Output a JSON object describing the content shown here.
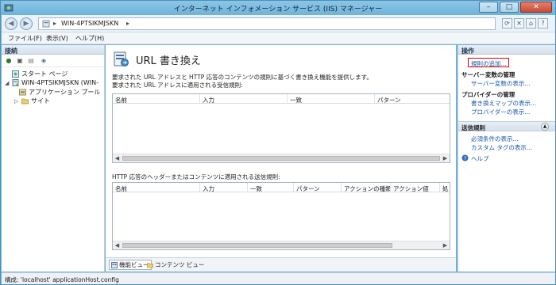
{
  "window": {
    "title": "インターネット インフォメーション サービス (IIS) マネージャー"
  },
  "address": {
    "segments": [
      "WIN-4PTSIKMJSKN"
    ]
  },
  "menu": {
    "items": [
      "ファイル(F)",
      "表示(V)",
      "ヘルプ(H)"
    ]
  },
  "connections": {
    "header": "接続",
    "tree": [
      {
        "label": "スタート ページ",
        "icon": "start-page-icon"
      },
      {
        "label": "WIN-4PTSIKMJSKN (WIN-",
        "icon": "server-icon"
      },
      {
        "label": "アプリケーション プール",
        "icon": "app-pool-icon"
      },
      {
        "label": "サイト",
        "icon": "sites-folder-icon"
      }
    ]
  },
  "feature": {
    "title": "URL 書き換え",
    "description": "要求された URL アドレスと HTTP 応答のコンテンツの規則に基づく書き換え機能を提供します。",
    "inbound_label": "要求された URL アドレスに適用される受信規則:",
    "inbound_columns": [
      "名前",
      "入力",
      "一致",
      "パターン"
    ],
    "outbound_label": "HTTP 応答のヘッダーまたはコンテンツに適用される送信規則:",
    "outbound_columns": [
      "名前",
      "入力",
      "一致",
      "パターン",
      "アクションの種類",
      "アクション値",
      "処"
    ]
  },
  "view_tabs": [
    "機能ビュー",
    "コンテンツ ビュー"
  ],
  "actions": {
    "header": "操作",
    "add_rule": "規則の追加...",
    "server_vars_head": "サーバー変数の管理",
    "server_vars_view": "サーバー変数の表示...",
    "providers_head": "プロバイダーの管理",
    "rewrite_maps": "書き換えマップの表示...",
    "providers_view": "プロバイダーの表示...",
    "outbound_section": "送信規則",
    "preconditions": "必須条件の表示...",
    "custom_tags": "カスタム タグの表示...",
    "help": "ヘルプ"
  },
  "status": {
    "text": "構成: 'localhost' applicationHost.config"
  },
  "colors": {
    "titlebar": "#6fb3d8",
    "link": "#1a57a8",
    "highlight": "#e00000"
  }
}
